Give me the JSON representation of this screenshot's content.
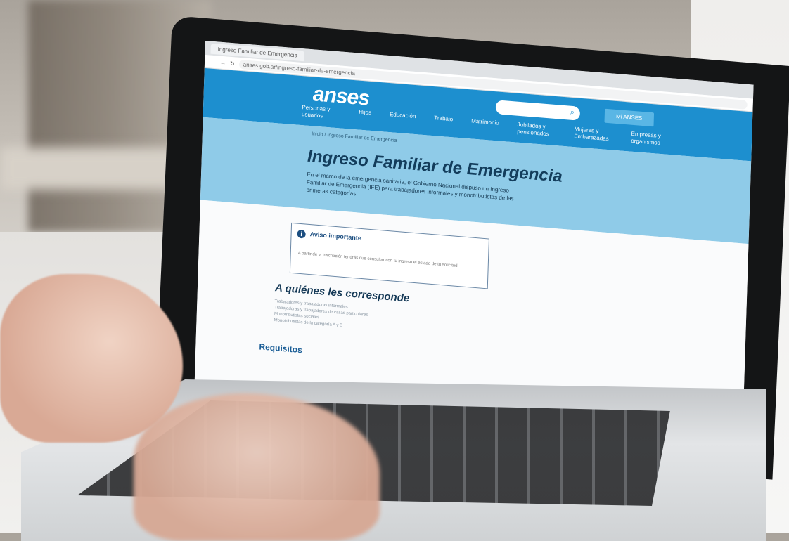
{
  "browser": {
    "tab_title": "Ingreso Familiar de Emergencia",
    "url": "anses.gob.ar/ingreso-familiar-de-emergencia"
  },
  "site": {
    "logo": "anses",
    "search_placeholder": "",
    "login_label": "Mi ANSES",
    "nav": [
      "Personas y usuarios",
      "Hijos",
      "Educación",
      "Trabajo",
      "Matrimonio",
      "Jubilados y pensionados",
      "Mujeres y Embarazadas",
      "Empresas y organismos"
    ]
  },
  "hero": {
    "breadcrumb": "Inicio / Ingreso Familiar de Emergencia",
    "title": "Ingreso Familiar de Emergencia",
    "lead": "En el marco de la emergencia sanitaria, el Gobierno Nacional dispuso un Ingreso Familiar de Emergencia (IFE) para trabajadores informales y monotributistas de las primeras categorías."
  },
  "notice": {
    "title": "Aviso importante",
    "body": "A partir de la inscripción tendrás que consultar con tu ingreso el estado de tu solicitud."
  },
  "section": {
    "title": "A quiénes les corresponde",
    "items": [
      "Trabajadores y trabajadoras informales",
      "Trabajadoras y trabajadores de casas particulares",
      "Monotributistas sociales",
      "Monotributistas de la categoría A y B"
    ],
    "requirements_title": "Requisitos"
  }
}
